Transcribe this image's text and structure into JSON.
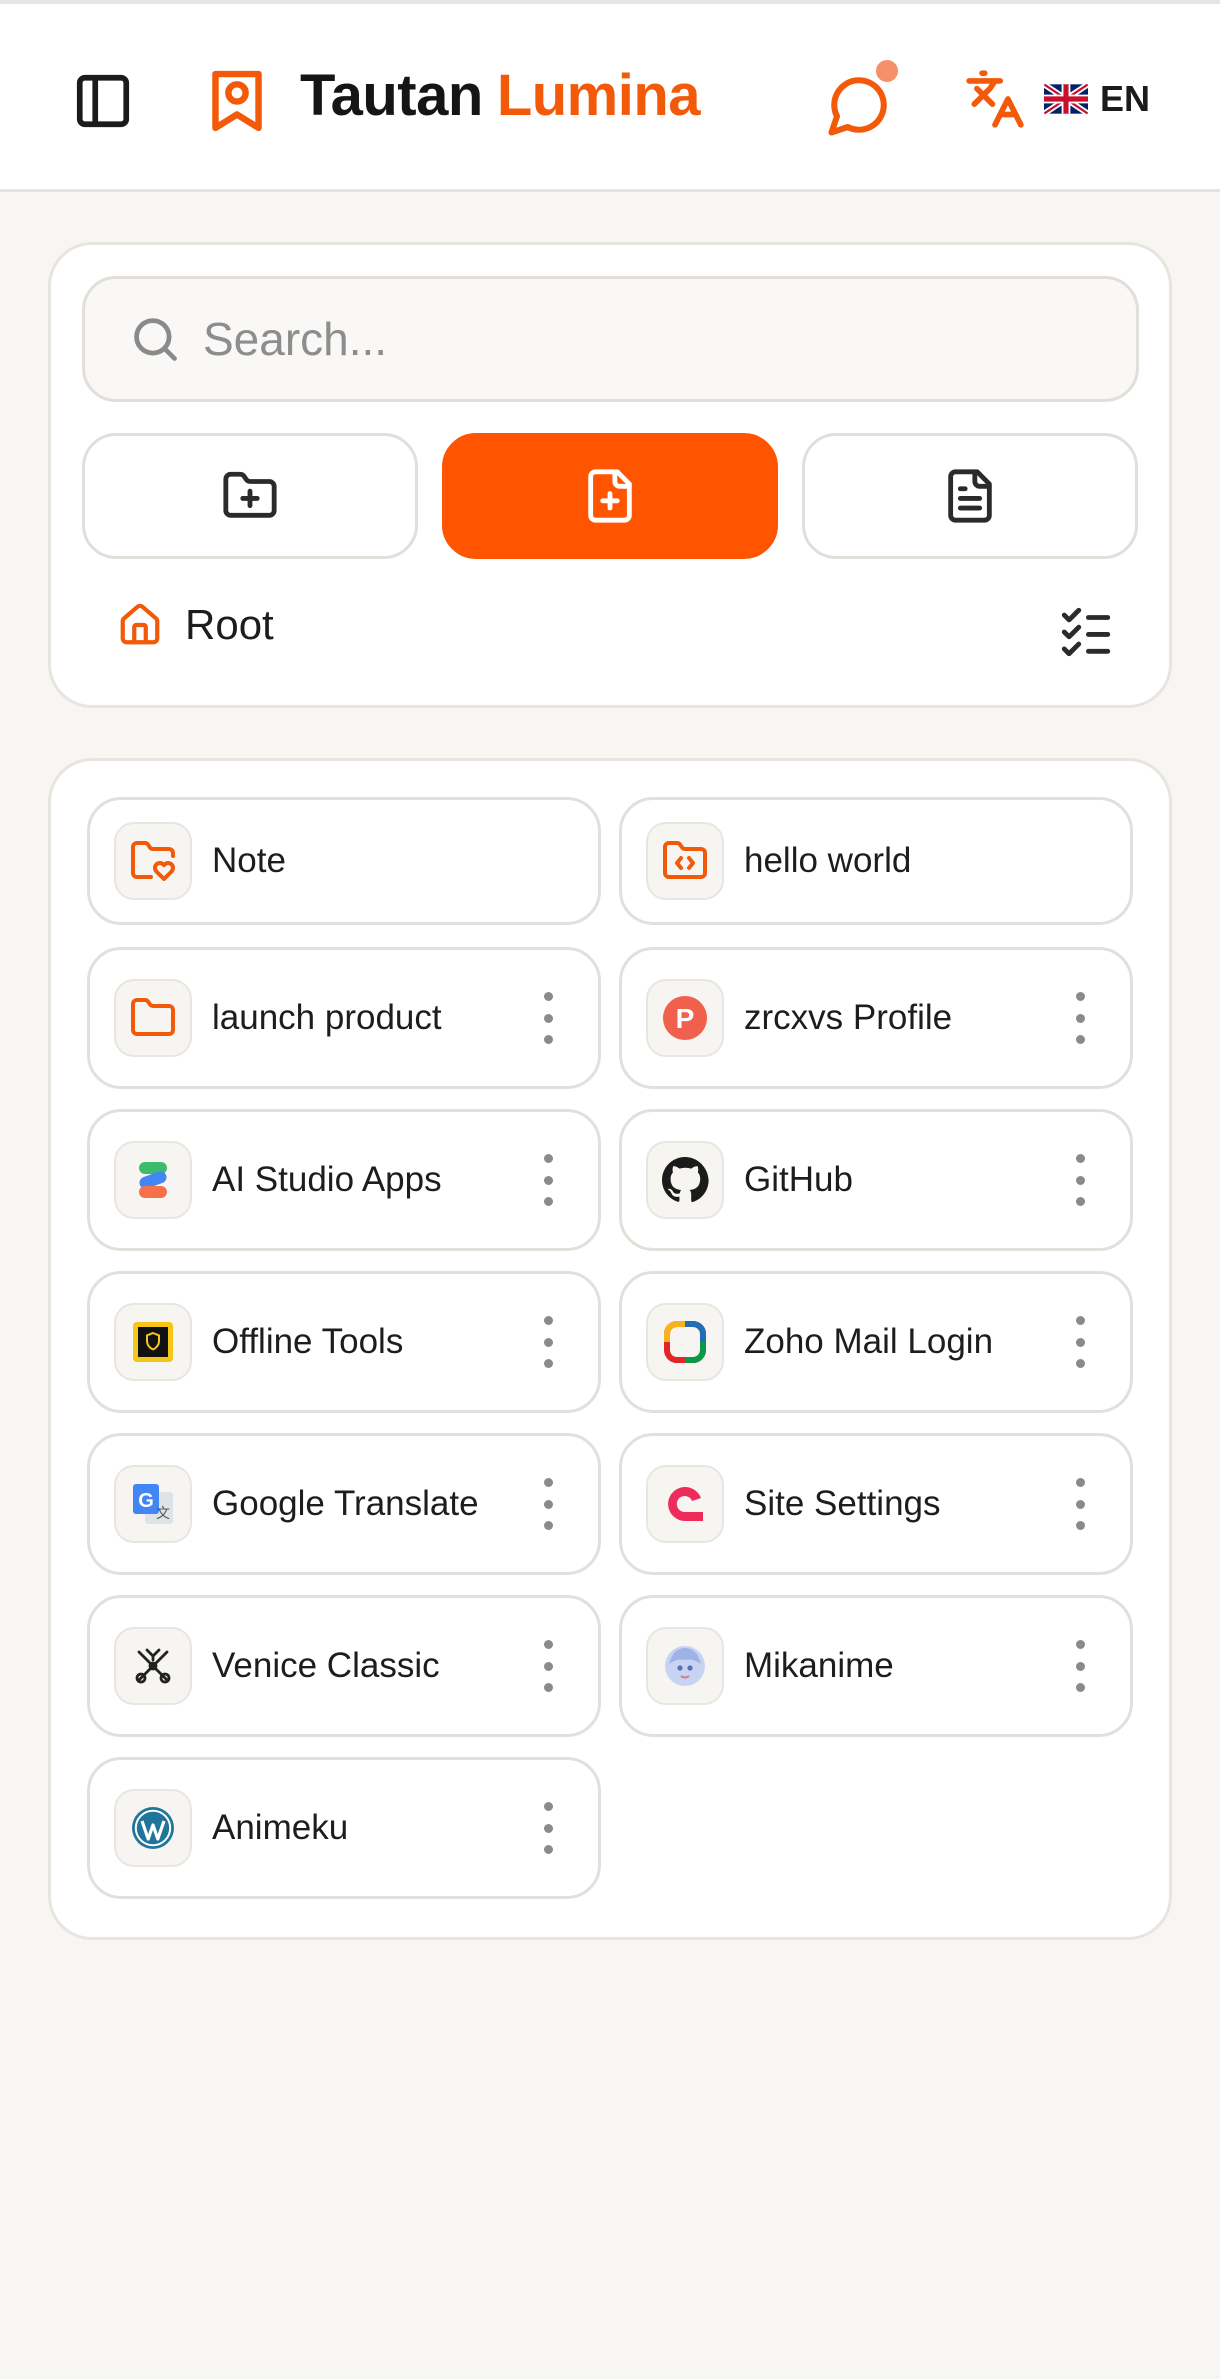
{
  "header": {
    "brand_primary": "Tautan",
    "brand_accent": "Lumina",
    "accent_color": "#f25a0a",
    "notification_dot_color": "#f4906a",
    "language_code": "EN",
    "language_flag": "uk-flag-icon"
  },
  "toolbar": {
    "search_placeholder": "Search...",
    "search_value": "",
    "new_folder_icon": "folder-plus-icon",
    "new_link_icon": "file-plus-icon",
    "notes_icon": "file-text-icon",
    "primary_color": "#ff5500",
    "breadcrumb_icon": "home-icon",
    "breadcrumb_label": "Root",
    "select_mode_icon": "checklist-icon"
  },
  "items": [
    {
      "label": "Note",
      "icon": "folder-heart-icon",
      "has_menu": false
    },
    {
      "label": "hello world",
      "icon": "folder-code-icon",
      "has_menu": false
    },
    {
      "label": "launch product",
      "icon": "folder-icon",
      "has_menu": true
    },
    {
      "label": "zrcxvs Profile",
      "icon": "p-badge-icon",
      "has_menu": true
    },
    {
      "label": "AI Studio Apps",
      "icon": "ai-studio-icon",
      "has_menu": true
    },
    {
      "label": "GitHub",
      "icon": "github-icon",
      "has_menu": true
    },
    {
      "label": "Offline Tools",
      "icon": "shield-square-icon",
      "has_menu": true
    },
    {
      "label": "Zoho Mail Login",
      "icon": "zoho-mail-icon",
      "has_menu": true
    },
    {
      "label": "Google Translate",
      "icon": "google-translate-icon",
      "has_menu": true
    },
    {
      "label": "Site Settings",
      "icon": "site-settings-icon",
      "has_menu": true
    },
    {
      "label": "Venice Classic",
      "icon": "venice-emblem-icon",
      "has_menu": true
    },
    {
      "label": "Mikanime",
      "icon": "anime-avatar-icon",
      "has_menu": true
    },
    {
      "label": "Animeku",
      "icon": "wordpress-icon",
      "has_menu": true
    }
  ]
}
